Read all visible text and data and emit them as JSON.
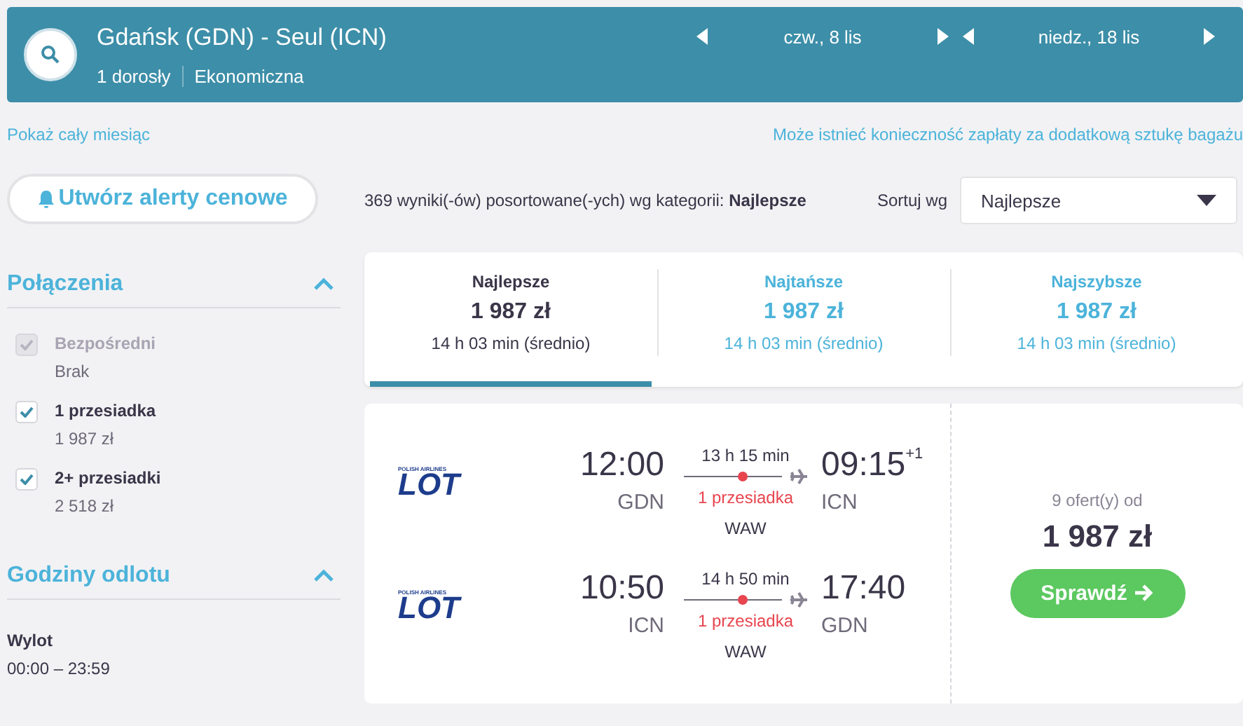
{
  "header": {
    "route": "Gdańsk (GDN) - Seul (ICN)",
    "passengers": "1 dorosły",
    "cabin": "Ekonomiczna",
    "dates": [
      "czw., 8 lis",
      "niedz., 18 lis"
    ]
  },
  "links": {
    "show_month": "Pokaż cały miesiąc",
    "baggage_note": "Może istnieć konieczność zapłaty za dodatkową sztukę bagażu"
  },
  "alert_button": "Utwórz alerty cenowe",
  "connections": {
    "title": "Połączenia",
    "expanded": true,
    "items": [
      {
        "label": "Bezpośredni",
        "price": "Brak",
        "checked": true,
        "disabled": true
      },
      {
        "label": "1 przesiadka",
        "price": "1 987 zł",
        "checked": true,
        "disabled": false
      },
      {
        "label": "2+ przesiadki",
        "price": "2 518 zł",
        "checked": true,
        "disabled": false
      }
    ]
  },
  "departure_times": {
    "title": "Godziny odlotu",
    "expanded": true,
    "items": [
      {
        "label": "Wylot",
        "value": "00:00 – 23:59"
      }
    ]
  },
  "results": {
    "summary": "369 wyniki(-ów) posortowane(-ych) wg kategorii: **Najlepsze**",
    "sort_label": "Sortuj wg",
    "sort_value": "Najlepsze"
  },
  "tabs": [
    {
      "label": "Najlepsze",
      "price": "1 987 zł",
      "duration": "14 h 03 min (średnio)",
      "selected": true
    },
    {
      "label": "Najtańsze",
      "price": "1 987 zł",
      "duration": "14 h 03 min (średnio)",
      "selected": false
    },
    {
      "label": "Najszybsze",
      "price": "1 987 zł",
      "duration": "14 h 03 min (średnio)",
      "selected": false
    }
  ],
  "offer": {
    "legs": [
      {
        "airline": "LOT",
        "airline_sub": "POLISH AIRLINES",
        "dep_time": "12:00",
        "dep_airport": "GDN",
        "duration": "13 h 15 min",
        "stops": "1 przesiadka",
        "via": "WAW",
        "arr_time": "09:15",
        "arr_day_offset": "+1",
        "arr_airport": "ICN"
      },
      {
        "airline": "LOT",
        "airline_sub": "POLISH AIRLINES",
        "dep_time": "10:50",
        "dep_airport": "ICN",
        "duration": "14 h 50 min",
        "stops": "1 przesiadka",
        "via": "WAW",
        "arr_time": "17:40",
        "arr_airport": "GDN"
      }
    ],
    "offers_count": "9 ofert(y) od",
    "price": "1 987 zł",
    "button": "Sprawdź"
  }
}
